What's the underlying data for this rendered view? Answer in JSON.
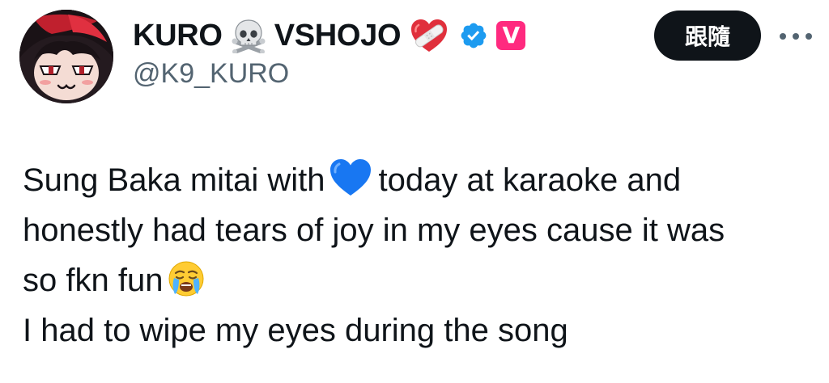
{
  "author": {
    "display_name_part1": "KURO",
    "display_name_part2": "VSHOJO",
    "handle": "@K9_KURO",
    "badge_letter": "V",
    "name_emojis": [
      "skull-crossbones-icon",
      "mending-heart-icon"
    ],
    "verified_color": "#1d9bf0"
  },
  "actions": {
    "follow_label": "跟隨",
    "more_icon": "more-dots-icon"
  },
  "tweet": {
    "line1_a": "Sung Baka mitai with",
    "line1_b": "today at karaoke and",
    "line2": "honestly had tears of joy in my eyes cause it was",
    "line3": "so fkn fun",
    "line4": "I had to wipe my eyes during the song",
    "inline_emojis": [
      "blue-heart-icon",
      "crying-face-icon"
    ]
  },
  "colors": {
    "text": "#0f1419",
    "secondary_text": "#536471",
    "follow_button_bg": "#0f1419",
    "badge_pink": "#ff2a7f"
  }
}
